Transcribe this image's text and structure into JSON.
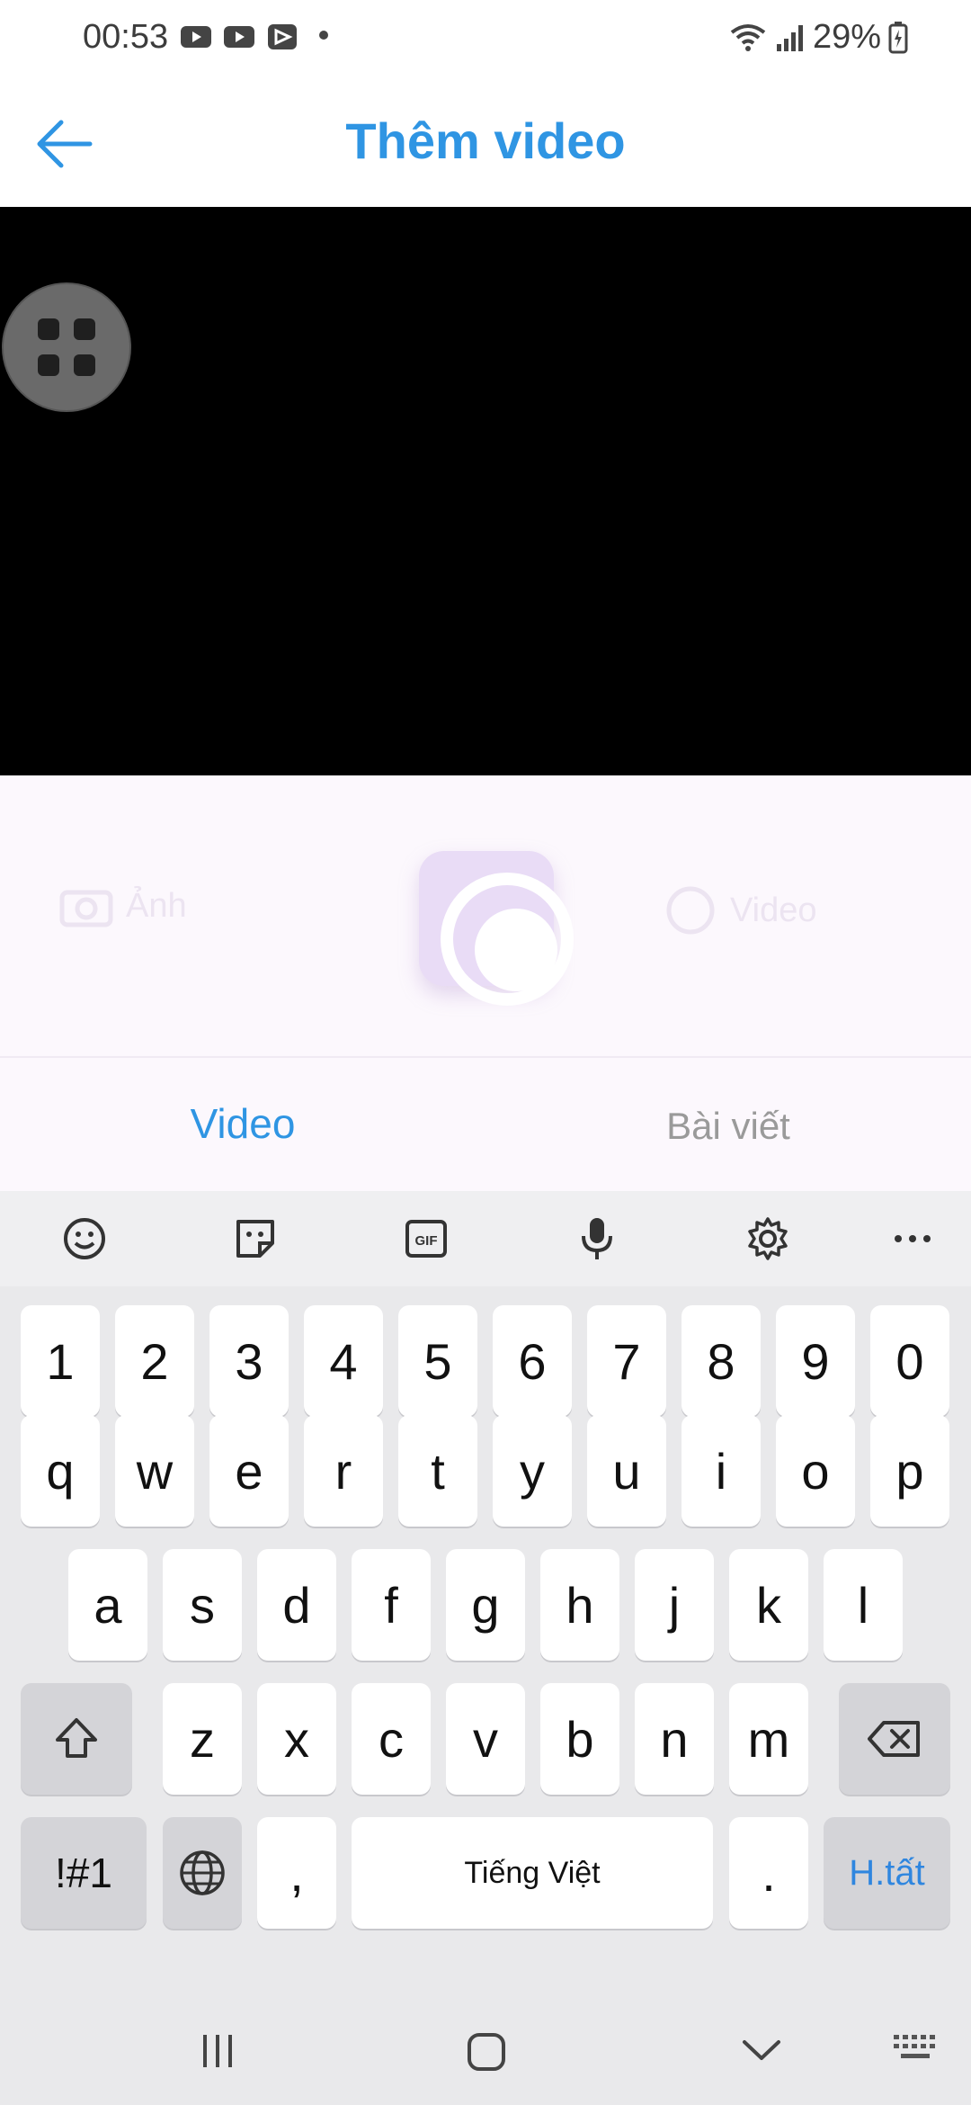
{
  "status_bar": {
    "time": "00:53",
    "battery": "29%"
  },
  "app_bar": {
    "title": "Thêm video"
  },
  "modes": {
    "left_label": "Ảnh",
    "right_label": "Video"
  },
  "tabs": {
    "video": "Video",
    "posts": "Bài viết"
  },
  "keyboard": {
    "number_row": [
      "1",
      "2",
      "3",
      "4",
      "5",
      "6",
      "7",
      "8",
      "9",
      "0"
    ],
    "row1": [
      "q",
      "w",
      "e",
      "r",
      "t",
      "y",
      "u",
      "i",
      "o",
      "p"
    ],
    "row2": [
      "a",
      "s",
      "d",
      "f",
      "g",
      "h",
      "j",
      "k",
      "l"
    ],
    "row3": [
      "z",
      "x",
      "c",
      "v",
      "b",
      "n",
      "m"
    ],
    "symbols_key": "!#1",
    "comma_key": ",",
    "space_label": "Tiếng Việt",
    "period_key": ".",
    "enter_label": "H.tất"
  },
  "colors": {
    "accent": "#2f95e3",
    "video_bg": "#000000",
    "keyboard_bg": "#e9e9eb"
  }
}
